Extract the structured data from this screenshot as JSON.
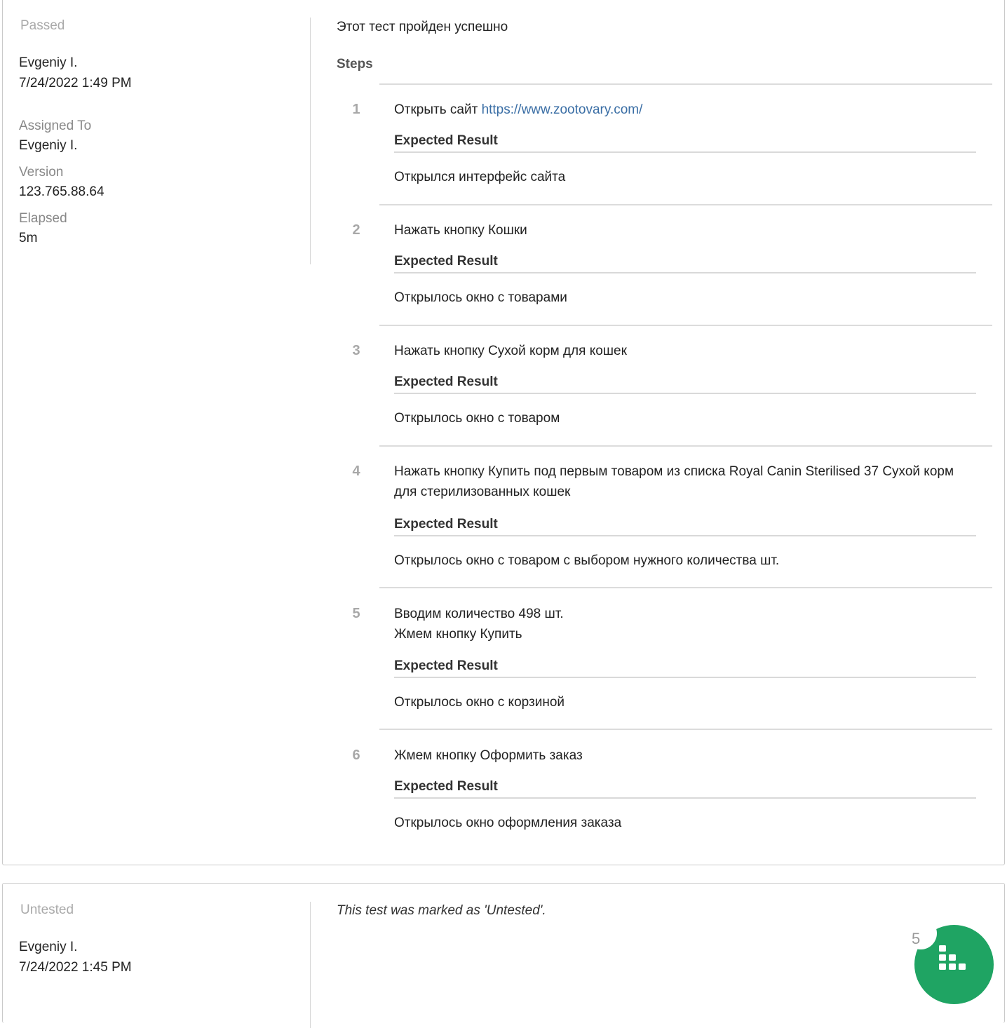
{
  "results": [
    {
      "status": "Passed",
      "author": "Evgeniy I.",
      "datetime": "7/24/2022 1:49 PM",
      "assigned_label": "Assigned To",
      "assigned_value": "Evgeniy I.",
      "version_label": "Version",
      "version_value": "123.765.88.64",
      "elapsed_label": "Elapsed",
      "elapsed_value": "5m",
      "summary": "Этот тест пройден успешно",
      "steps_heading": "Steps",
      "steps": [
        {
          "num": "1",
          "text": "Открыть сайт ",
          "link": "https://www.zootovary.com/",
          "expected_label": "Expected Result",
          "expected": "Открылся интерфейс сайта"
        },
        {
          "num": "2",
          "text": "Нажать кнопку Кошки",
          "expected_label": "Expected Result",
          "expected": "Открылось окно с товарами"
        },
        {
          "num": "3",
          "text": "Нажать кнопку Сухой корм для кошек",
          "expected_label": "Expected Result",
          "expected": "Открылось окно с товаром"
        },
        {
          "num": "4",
          "text": "Нажать кнопку Купить под первым товаром из списка Royal Canin Sterilised 37 Сухой корм для стерилизованных кошек",
          "expected_label": "Expected Result",
          "expected": "Открылось окно с товаром с выбором нужного количества шт."
        },
        {
          "num": "5",
          "text_line1": "Вводим количество 498 шт.",
          "text_line2": "Жмем кнопку Купить",
          "expected_label": "Expected Result",
          "expected": "Открылось окно с корзиной"
        },
        {
          "num": "6",
          "text": "Жмем кнопку Оформить заказ",
          "expected_label": "Expected Result",
          "expected": "Открылось окно оформления заказа"
        }
      ]
    },
    {
      "status": "Untested",
      "author": "Evgeniy I.",
      "datetime": "7/24/2022 1:45 PM",
      "message": "This test was marked as 'Untested'."
    }
  ],
  "widget": {
    "badge_count": "5",
    "icon": "grid-dots-icon",
    "color": "#1fa463"
  }
}
